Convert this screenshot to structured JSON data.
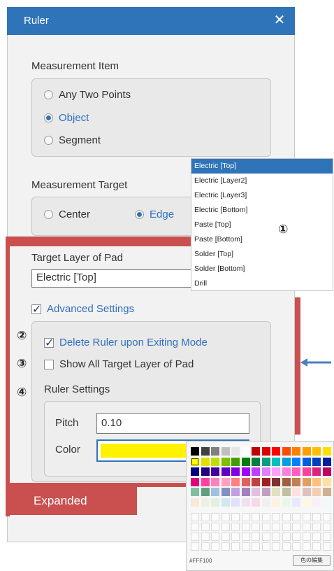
{
  "window": {
    "title": "Ruler"
  },
  "measurement_item": {
    "label": "Measurement Item",
    "options": [
      "Any Two Points",
      "Object",
      "Segment"
    ],
    "selected": "Object"
  },
  "measurement_target": {
    "label": "Measurement Target",
    "options": [
      "Center",
      "Edge"
    ],
    "selected": "Edge"
  },
  "target_layer": {
    "label": "Target Layer of Pad",
    "value": "Electric [Top]",
    "dropdown_options": [
      "Electric [Top]",
      "Electric [Layer2]",
      "Electric [Layer3]",
      "Electric [Bottom]",
      "Paste [Top]",
      "Paste [Bottom]",
      "Solder [Top]",
      "Solder [Bottom]",
      "Drill"
    ],
    "selected": "Electric [Top]"
  },
  "advanced": {
    "label": "Advanced Settings",
    "checked": true,
    "delete_ruler": {
      "label": "Delete Ruler upon Exiting Mode",
      "checked": true
    },
    "show_all": {
      "label": "Show All Target Layer of Pad",
      "checked": false
    },
    "ruler_settings": {
      "label": "Ruler Settings",
      "pitch_label": "Pitch",
      "pitch_value": "0.10",
      "color_label": "Color",
      "color_value": "#FFF100"
    }
  },
  "annotations": {
    "n1": "①",
    "n2": "②",
    "n3": "③",
    "n4": "④",
    "expanded": "Expanded"
  },
  "palette": {
    "hex_readout": "#FFF100",
    "edit_button": "色の編集",
    "rows": [
      [
        "#000000",
        "#404040",
        "#7f7f7f",
        "#bfbfbf",
        "#e5e5e5",
        "#ffffff",
        "#c00000",
        "#e00000",
        "#ff0000",
        "#ff4b00",
        "#ff7f00",
        "#ff9f00",
        "#ffbf00",
        "#ffdf00"
      ],
      [
        "#ffff00",
        "#e0e000",
        "#bfdf00",
        "#7fbf00",
        "#3f9f00",
        "#007f00",
        "#00803f",
        "#009f7f",
        "#00bfbf",
        "#00a0e0",
        "#0080ff",
        "#005fdf",
        "#0040bf",
        "#00209f"
      ],
      [
        "#00007f",
        "#20007f",
        "#40009f",
        "#6000bf",
        "#8000df",
        "#a000ff",
        "#bf3fff",
        "#df7fff",
        "#ff9fff",
        "#ff7fdf",
        "#ff5fbf",
        "#ff3f9f",
        "#df207f",
        "#bf005f"
      ],
      [
        "#e0007f",
        "#ff409f",
        "#ff80bf",
        "#ffa0c0",
        "#ff8080",
        "#e06060",
        "#c04040",
        "#a02020",
        "#803030",
        "#a06040",
        "#c08050",
        "#e0a060",
        "#ffc080",
        "#ffe0a0"
      ],
      [
        "#80c0a0",
        "#60a080",
        "#a0c0e0",
        "#8090c0",
        "#c0a0e0",
        "#a080c0",
        "#e0c0e0",
        "#c0a0c0",
        "#e0e0c0",
        "#c0c0a0",
        "#ffe0e0",
        "#e0c0c0",
        "#f0d0b0",
        "#d0b090"
      ],
      [
        "#f8e8d8",
        "#f0f0e0",
        "#e0f0e0",
        "#d0e8f0",
        "#e0e0f8",
        "#f0e0f0",
        "#f8d8e8",
        "#f0f0f0",
        "#fff0e0",
        "#e8f8e8",
        "#e8e8ff",
        "#fff8e0",
        "#f8f0f8",
        "#f0f8f8"
      ]
    ],
    "selected_color": "#ffff00"
  },
  "colors": {
    "title_bar": "#2f73b9",
    "accent": "#2f6fbf",
    "annotation_frame": "#c9504e",
    "arrow": "#4a7fc1"
  }
}
